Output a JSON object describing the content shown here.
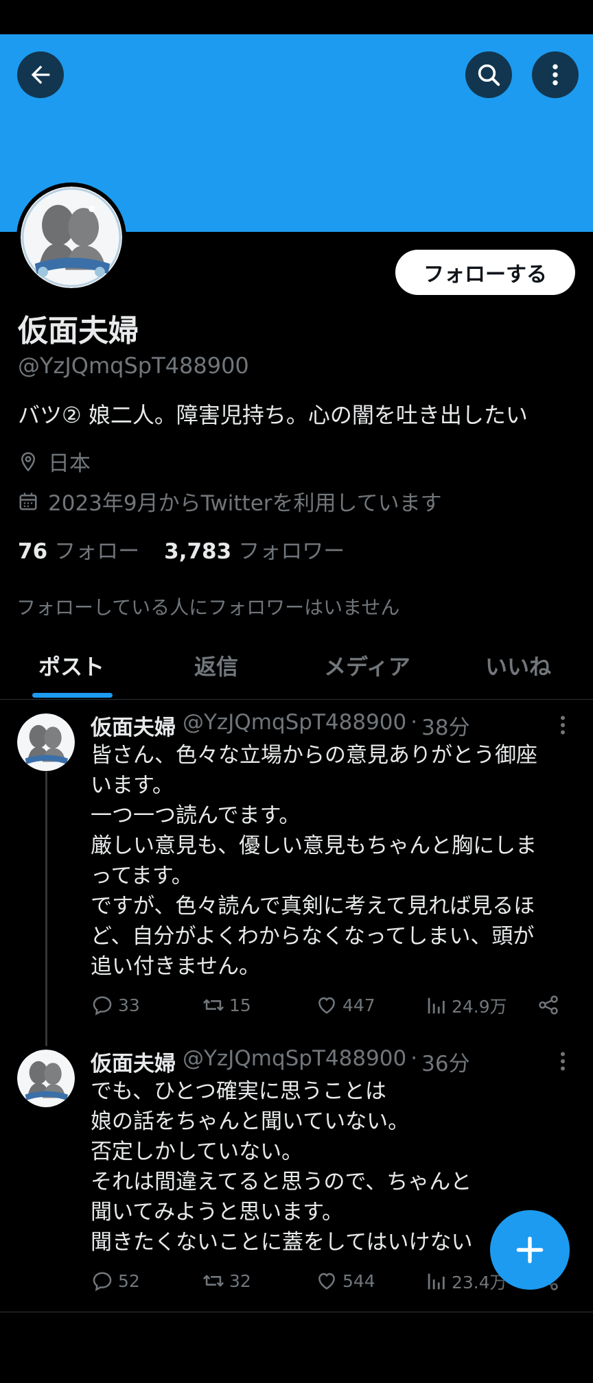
{
  "colors": {
    "banner": "#1d9bf0",
    "accent": "#1d9bf0",
    "background": "#000000",
    "text_primary": "#e7e9ea",
    "text_secondary": "#71767b"
  },
  "header": {
    "back_icon": "arrow-left-icon",
    "search_icon": "search-icon",
    "more_icon": "more-vertical-icon"
  },
  "profile": {
    "follow_label": "フォローする",
    "name": "仮面夫婦",
    "handle": "@YzJQmqSpT488900",
    "bio": "バツ② 娘二人。障害児持ち。心の闇を吐き出したい",
    "location": "日本",
    "joined": "2023年9月からTwitterを利用しています",
    "following_count": "76",
    "following_label": "フォロー",
    "followers_count": "3,783",
    "followers_label": "フォロワー",
    "mutual_note": "フォローしている人にフォロワーはいません"
  },
  "tabs": [
    {
      "label": "ポスト",
      "active": true
    },
    {
      "label": "返信",
      "active": false
    },
    {
      "label": "メディア",
      "active": false
    },
    {
      "label": "いいね",
      "active": false
    }
  ],
  "tweets": [
    {
      "name": "仮面夫婦",
      "handle": "@YzJQmqSpT488900",
      "dot": "·",
      "time": "38分",
      "text": "皆さん、色々な立場からの意見ありがとう御座\nいます。\n一つ一つ読んでます。\n厳しい意見も、優しい意見もちゃんと胸にしま\nってます。\nですが、色々読んで真剣に考えて見れば見るほ\nど、自分がよくわからなくなってしまい、頭が\n追い付きません。",
      "replies": "33",
      "retweets": "15",
      "likes": "447",
      "views": "24.9万"
    },
    {
      "name": "仮面夫婦",
      "handle": "@YzJQmqSpT488900",
      "dot": "·",
      "time": "36分",
      "text": "でも、ひとつ確実に思うことは\n娘の話をちゃんと聞いていない。\n否定しかしていない。\nそれは間違えてると思うので、ちゃんと\n聞いてみようと思います。\n聞きたくないことに蓋をしてはいけない",
      "replies": "52",
      "retweets": "32",
      "likes": "544",
      "views": "23.4万"
    }
  ],
  "fab": {
    "icon": "plus-icon"
  }
}
